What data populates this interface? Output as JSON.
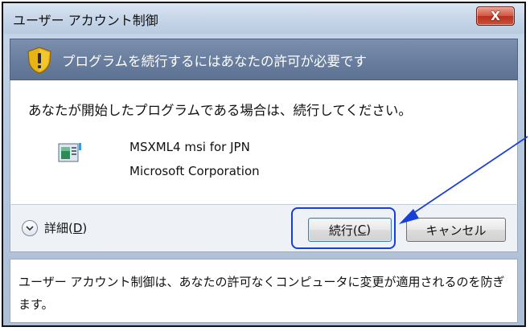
{
  "window": {
    "title": "ユーザー アカウント制御",
    "close_label": "X"
  },
  "header": {
    "icon": "uac-shield-icon",
    "text": "プログラムを続行するにはあなたの許可が必要です"
  },
  "content": {
    "message": "あなたが開始したプログラムである場合は、続行してください。",
    "program_icon": "installer-program-icon",
    "program_name": "MSXML4 msi for JPN",
    "publisher": "Microsoft Corporation"
  },
  "footer": {
    "details_label": "詳細(",
    "details_key": "D",
    "details_suffix": ")",
    "continue_label": "続行(",
    "continue_key": "C",
    "continue_suffix": ")",
    "cancel_label": "キャンセル"
  },
  "info": {
    "text": "ユーザー アカウント制御は、あなたの許可なくコンピュータに変更が適用されるのを防ぎます。"
  },
  "colors": {
    "highlight": "#1a3fd6",
    "header_band": "#6e82a3",
    "close_button": "#c9503a"
  }
}
